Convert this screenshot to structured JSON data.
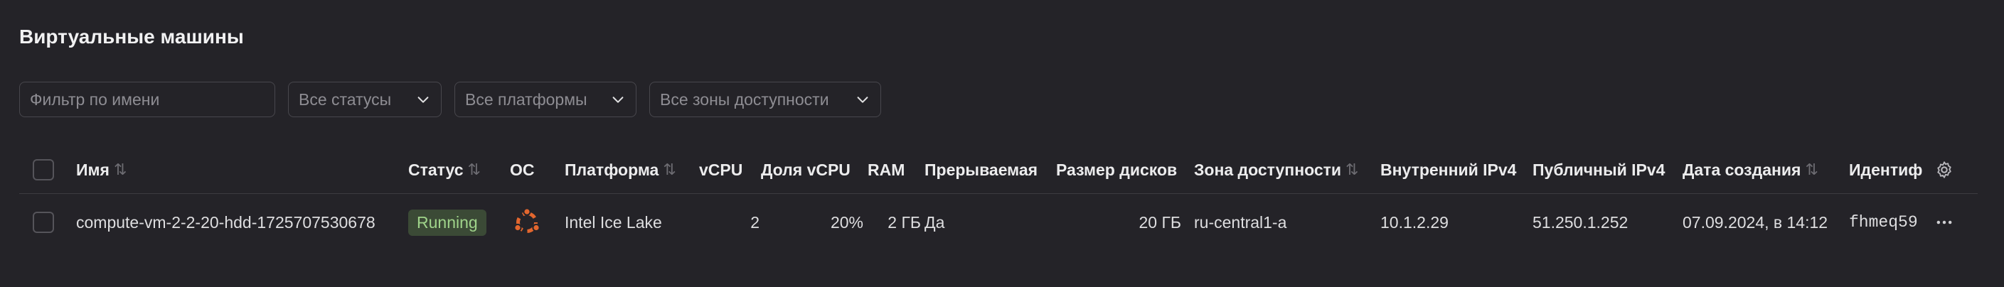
{
  "page_title": "Виртуальные машины",
  "filters": {
    "name_placeholder": "Фильтр по имени",
    "status": "Все статусы",
    "platform": "Все платформы",
    "zone": "Все зоны доступности"
  },
  "columns": {
    "name": "Имя",
    "status": "Статус",
    "os": "ОС",
    "platform": "Платформа",
    "vcpu": "vCPU",
    "vcpu_share": "Доля vCPU",
    "ram": "RAM",
    "preemptible": "Прерываемая",
    "disk_size": "Размер дисков",
    "zone": "Зона доступности",
    "internal_ipv4": "Внутренний IPv4",
    "public_ipv4": "Публичный IPv4",
    "created": "Дата создания",
    "id": "Идентиф"
  },
  "rows": [
    {
      "name": "compute-vm-2-2-20-hdd-1725707530678",
      "status": "Running",
      "os_icon": "ubuntu-icon",
      "platform": "Intel Ice Lake",
      "vcpu": "2",
      "vcpu_share": "20%",
      "ram": "2 ГБ",
      "preemptible": "Да",
      "disk_size": "20 ГБ",
      "zone": "ru-central1-a",
      "internal_ipv4": "10.1.2.29",
      "public_ipv4": "51.250.1.252",
      "created": "07.09.2024, в 14:12",
      "id": "fhmeq59"
    }
  ],
  "colors": {
    "background": "#242328",
    "status_running_bg": "#3b4a36",
    "status_running_text": "#9fd38a",
    "ubuntu_orange": "#e2662e"
  }
}
